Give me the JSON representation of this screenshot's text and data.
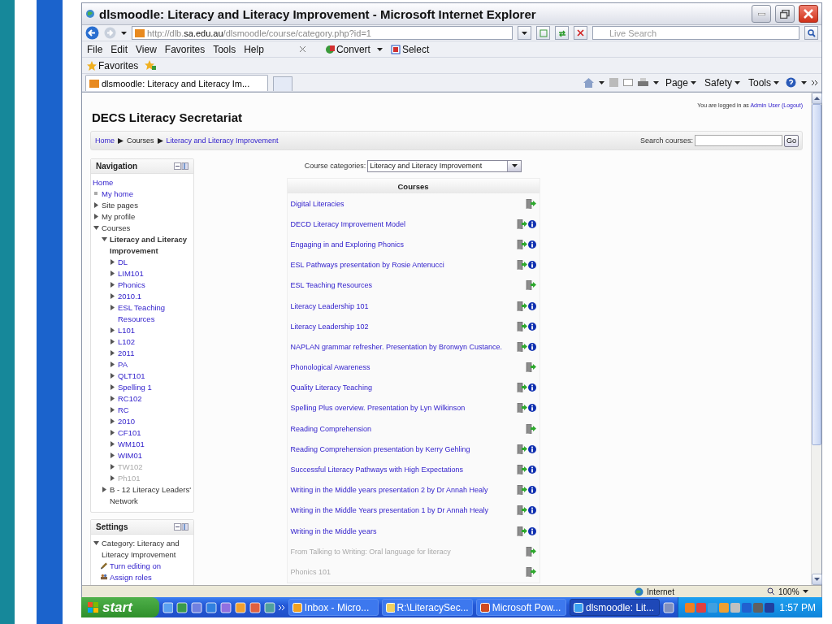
{
  "window": {
    "title": "dlsmoodle: Literacy and Literacy Improvement - Microsoft Internet Explorer"
  },
  "address_bar": {
    "url": [
      {
        "text": "http://dlb.",
        "strong": false
      },
      {
        "text": "sa.edu.au",
        "strong": true
      },
      {
        "text": "/dlsmoodle/course/category.php?id=1",
        "strong": false
      }
    ]
  },
  "search": {
    "placeholder": "Live Search"
  },
  "menu": [
    "File",
    "Edit",
    "View",
    "Favorites",
    "Tools",
    "Help"
  ],
  "toolbar": [
    {
      "label": "Convert",
      "kind": "convert"
    },
    {
      "label": "Select",
      "kind": "select"
    }
  ],
  "favorites_bar": {
    "label": "Favorites"
  },
  "tabs": [
    {
      "label": "dlsmoodle: Literacy and Literacy Im...",
      "selected": true
    }
  ],
  "command_bar": [
    "Page",
    "Safety",
    "Tools"
  ],
  "page": {
    "site_title": "DECS Literacy Secretariat",
    "login": {
      "prefix": "You are logged in as",
      "user": "Admin User",
      "logout": "(Logout)"
    },
    "breadcrumb": [
      {
        "label": "Home",
        "link": true
      },
      {
        "label": "Courses",
        "link": false
      },
      {
        "label": "Literacy and Literacy Improvement",
        "link": true
      }
    ],
    "search_courses": {
      "label": "Search courses:",
      "button": "Go"
    },
    "navigation": {
      "title": "Navigation",
      "items": [
        {
          "label": "Home",
          "kind": "root"
        },
        {
          "label": "My home",
          "kind": "page"
        },
        {
          "label": "Site pages",
          "kind": "section",
          "expanded": false
        },
        {
          "label": "My profile",
          "kind": "section",
          "expanded": false
        },
        {
          "label": "Courses",
          "kind": "section",
          "expanded": true,
          "children": [
            {
              "label": "Literacy and Literacy Improvement",
              "kind": "category",
              "current": true,
              "expanded": true,
              "children": [
                {
                  "label": "DL",
                  "kind": "course",
                  "expanded": false,
                  "hidden": false
                },
                {
                  "label": "LIM101",
                  "kind": "course",
                  "expanded": false,
                  "hidden": false
                },
                {
                  "label": "Phonics",
                  "kind": "course",
                  "expanded": false,
                  "hidden": false
                },
                {
                  "label": "2010.1",
                  "kind": "course",
                  "expanded": false,
                  "hidden": false
                },
                {
                  "label": "ESL Teaching Resources",
                  "kind": "course",
                  "expanded": false,
                  "hidden": false
                },
                {
                  "label": "L101",
                  "kind": "course",
                  "expanded": false,
                  "hidden": false
                },
                {
                  "label": "L102",
                  "kind": "course",
                  "expanded": false,
                  "hidden": false
                },
                {
                  "label": "2011",
                  "kind": "course",
                  "expanded": false,
                  "hidden": false
                },
                {
                  "label": "PA",
                  "kind": "course",
                  "expanded": false,
                  "hidden": false
                },
                {
                  "label": "QLT101",
                  "kind": "course",
                  "expanded": false,
                  "hidden": false
                },
                {
                  "label": "Spelling 1",
                  "kind": "course",
                  "expanded": false,
                  "hidden": false
                },
                {
                  "label": "RC102",
                  "kind": "course",
                  "expanded": false,
                  "hidden": false
                },
                {
                  "label": "RC",
                  "kind": "course",
                  "expanded": false,
                  "hidden": false
                },
                {
                  "label": "2010",
                  "kind": "course",
                  "expanded": false,
                  "hidden": false
                },
                {
                  "label": "CF101",
                  "kind": "course",
                  "expanded": false,
                  "hidden": false
                },
                {
                  "label": "WM101",
                  "kind": "course",
                  "expanded": false,
                  "hidden": false
                },
                {
                  "label": "WIM01",
                  "kind": "course",
                  "expanded": false,
                  "hidden": false
                },
                {
                  "label": "TW102",
                  "kind": "course",
                  "expanded": false,
                  "hidden": true
                },
                {
                  "label": "Ph101",
                  "kind": "course",
                  "expanded": false,
                  "hidden": true
                }
              ]
            },
            {
              "label": "B - 12 Literacy Leaders' Network",
              "kind": "category",
              "current": false,
              "expanded": false
            }
          ]
        }
      ]
    },
    "settings": {
      "title": "Settings",
      "items": [
        {
          "label": "Category: Literacy and Literacy Improvement",
          "kind": "section",
          "expanded": true,
          "children": [
            {
              "label": "Turn editing on",
              "kind": "edit"
            },
            {
              "label": "Assign roles",
              "kind": "roles"
            }
          ]
        }
      ]
    },
    "category_select": {
      "label": "Course categories:",
      "value": "Literacy and Literacy Improvement"
    },
    "courses": {
      "heading": "Courses",
      "rows": [
        {
          "name": "Digital Literacies",
          "has_summary": false,
          "hidden": false
        },
        {
          "name": "DECD Literacy Improvement Model",
          "has_summary": true,
          "hidden": false
        },
        {
          "name": "Engaging in and Exploring Phonics",
          "has_summary": true,
          "hidden": false
        },
        {
          "name": "ESL Pathways presentation by Rosie Antenucci",
          "has_summary": true,
          "hidden": false
        },
        {
          "name": "ESL Teaching Resources",
          "has_summary": false,
          "hidden": false
        },
        {
          "name": "Literacy Leadership 101",
          "has_summary": true,
          "hidden": false
        },
        {
          "name": "Literacy Leadership 102",
          "has_summary": true,
          "hidden": false
        },
        {
          "name": "NAPLAN grammar refresher. Presentation by Bronwyn Custance.",
          "has_summary": true,
          "hidden": false
        },
        {
          "name": "Phonological Awareness",
          "has_summary": false,
          "hidden": false
        },
        {
          "name": "Quality Literacy Teaching",
          "has_summary": true,
          "hidden": false
        },
        {
          "name": "Spelling Plus overview. Presentation by Lyn Wilkinson",
          "has_summary": true,
          "hidden": false
        },
        {
          "name": "Reading Comprehension",
          "has_summary": false,
          "hidden": false
        },
        {
          "name": "Reading Comprehension presentation by Kerry Gehling",
          "has_summary": true,
          "hidden": false
        },
        {
          "name": "Successful Literacy Pathways with High Expectations",
          "has_summary": true,
          "hidden": false
        },
        {
          "name": "Writing in the Middle years presentation 2 by Dr Annah Healy",
          "has_summary": true,
          "hidden": false
        },
        {
          "name": "Writing in the Middle Years presentation 1 by Dr Annah Healy",
          "has_summary": true,
          "hidden": false
        },
        {
          "name": "Writing in the Middle years",
          "has_summary": true,
          "hidden": false
        },
        {
          "name": "From Talking to Writing: Oral language for literacy",
          "has_summary": false,
          "hidden": true
        },
        {
          "name": "Phonics 101",
          "has_summary": false,
          "hidden": true
        }
      ]
    }
  },
  "status_bar": {
    "zone": "Internet",
    "zoom": "100%"
  },
  "taskbar": {
    "start": "start",
    "tasks": [
      {
        "label": "Inbox - Micro...",
        "kind": "mail",
        "selected": false
      },
      {
        "label": "R:\\LiteracySec...",
        "kind": "folder",
        "selected": false
      },
      {
        "label": "Microsoft Pow...",
        "kind": "slides",
        "selected": false
      },
      {
        "label": "dlsmoodle: Lit...",
        "kind": "browser",
        "selected": true
      }
    ],
    "clock": "1:57 PM"
  }
}
